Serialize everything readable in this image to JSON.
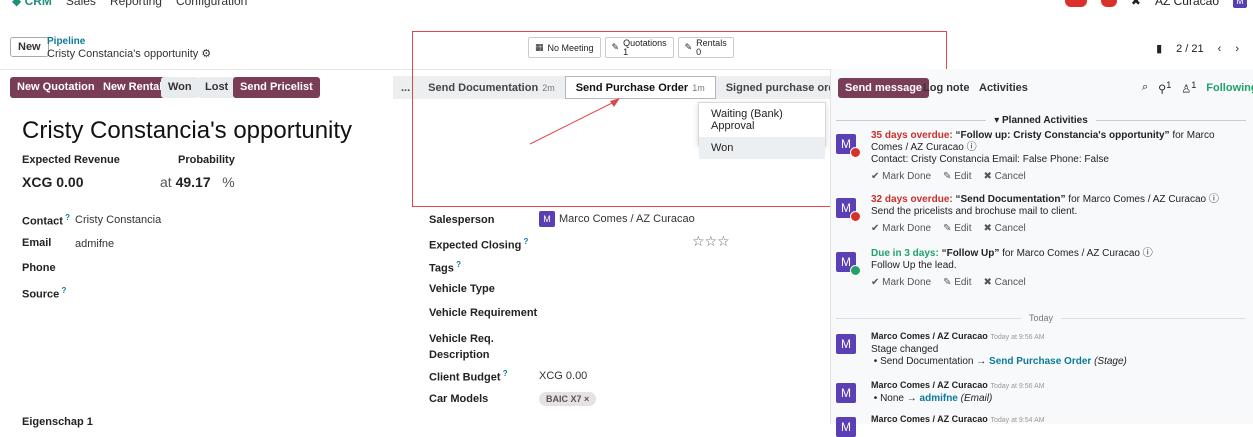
{
  "topnav": {
    "app": "CRM",
    "menus": [
      "Sales",
      "Reporting",
      "Configuration"
    ],
    "company": "AZ Curacao",
    "avatar": "M"
  },
  "breadcrumb": {
    "new_button": "New",
    "parent": "Pipeline",
    "current": "Cristy Constancia's opportunity"
  },
  "pager": {
    "text": "2 / 21"
  },
  "actions": {
    "new_quotation": "New Quotation",
    "new_rental": "New Rental",
    "won": "Won",
    "lost": "Lost",
    "send_pricelist": "Send Pricelist"
  },
  "stages": {
    "more_left": "...",
    "s1": "Send Documentation",
    "s1_time": "2m",
    "s2": "Send Purchase Order",
    "s2_time": "1m",
    "s3": "Signed purchase order",
    "more_right": "..."
  },
  "dropdown": {
    "item1": "Waiting (Bank) Approval",
    "item2": "Won"
  },
  "stats": {
    "meeting": "No Meeting",
    "quotations_label": "Quotations",
    "quotations_count": "1",
    "rentals_label": "Rentals",
    "rentals_count": "0"
  },
  "form": {
    "title": "Cristy Constancia's opportunity",
    "expected_revenue_label": "Expected Revenue",
    "probability_label": "Probability",
    "revenue_value": "XCG 0.00",
    "at": "at",
    "probability_value": "49.17",
    "pct": "%",
    "contact_label": "Contact",
    "contact_value": "Cristy Constancia",
    "email_label": "Email",
    "email_value": "admifne",
    "phone_label": "Phone",
    "source_label": "Source",
    "salesperson_label": "Salesperson",
    "salesperson_value": "Marco Comes / AZ Curacao",
    "salesperson_avatar": "M",
    "expected_closing_label": "Expected Closing",
    "tags_label": "Tags",
    "vehicle_type_label": "Vehicle Type",
    "vehicle_req_label": "Vehicle Requirement",
    "vehicle_desc_label_1": "Vehicle Req.",
    "vehicle_desc_label_2": "Description",
    "client_budget_label": "Client Budget",
    "client_budget_value": "XCG 0.00",
    "car_models_label": "Car Models",
    "car_models_tag": "BAIC X7 ×",
    "eigenschap_label": "Eigenschap 1",
    "stars": "☆☆☆"
  },
  "chatter": {
    "send_message": "Send message",
    "log_note": "Log note",
    "activities": "Activities",
    "counts": "1",
    "following": "Following",
    "planned": "▾ Planned Activities",
    "today": "Today",
    "a1": {
      "overdue": "35 days overdue:",
      "summary": "“Follow up: Cristy Constancia's opportunity”",
      "for": "for Marco Comes / AZ Curacao",
      "note": "Contact: Cristy Constancia Email: False Phone: False"
    },
    "a2": {
      "overdue": "32 days overdue:",
      "summary": "“Send Documentation”",
      "for": "for Marco Comes / AZ Curacao",
      "note": "Send the pricelists and brochuse mail to client."
    },
    "a3": {
      "due": "Due in 3 days:",
      "summary": "“Follow Up”",
      "for": "for Marco Comes / AZ Curacao",
      "note": "Follow Up the lead."
    },
    "mark_done": "✔ Mark Done",
    "edit": "✎ Edit",
    "cancel": "✖ Cancel",
    "m1": {
      "author": "Marco Comes / AZ Curacao",
      "time": "Today at 9:56 AM",
      "text": "Stage changed",
      "from": "Send Documentation",
      "to": "Send Purchase Order",
      "field": "(Stage)"
    },
    "m2": {
      "author": "Marco Comes / AZ Curacao",
      "time": "Today at 9:56 AM",
      "from": "None",
      "to": "admifne",
      "field": "(Email)"
    },
    "m3": {
      "author": "Marco Comes / AZ Curacao",
      "time": "Today at 9:54 AM"
    }
  }
}
